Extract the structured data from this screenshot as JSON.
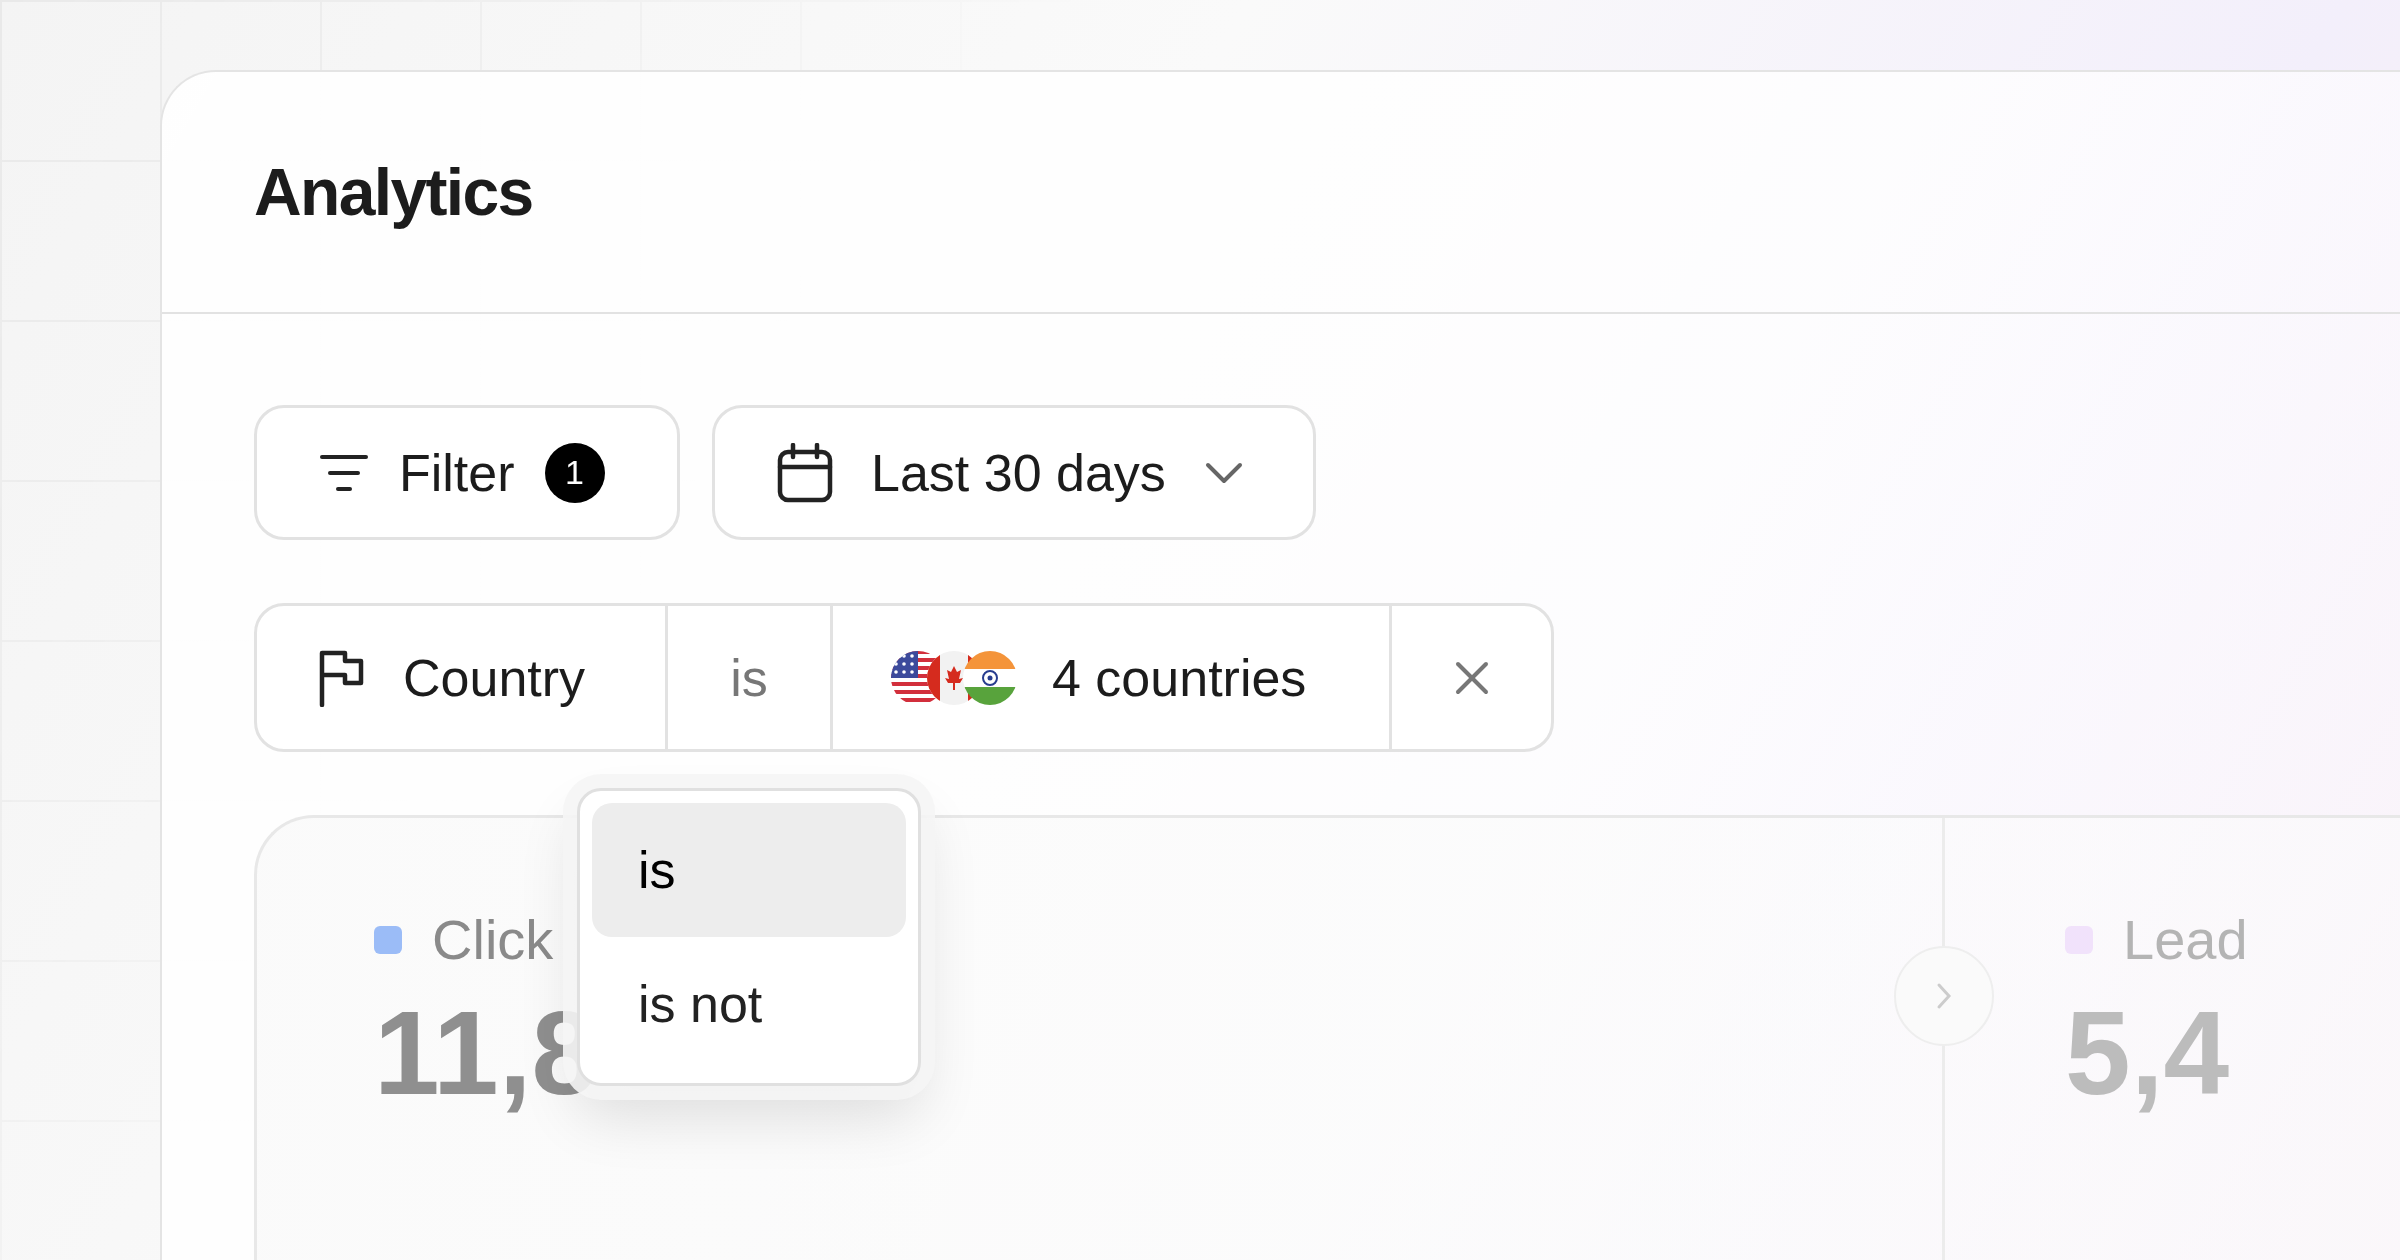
{
  "title": "Analytics",
  "toolbar": {
    "filter": {
      "label": "Filter",
      "count": "1"
    },
    "date_range": {
      "label": "Last 30 days"
    }
  },
  "filter_chip": {
    "field": "Country",
    "operator": "is",
    "value": "4 countries"
  },
  "operator_menu": {
    "options": [
      {
        "label": "is",
        "selected": true
      },
      {
        "label": "is not",
        "selected": false
      }
    ]
  },
  "stats": [
    {
      "label": "Click",
      "value": "11,8",
      "color": "#9bbcf7"
    },
    {
      "label": "Lead",
      "value": "5,4",
      "color": "#f1e2fb"
    }
  ]
}
